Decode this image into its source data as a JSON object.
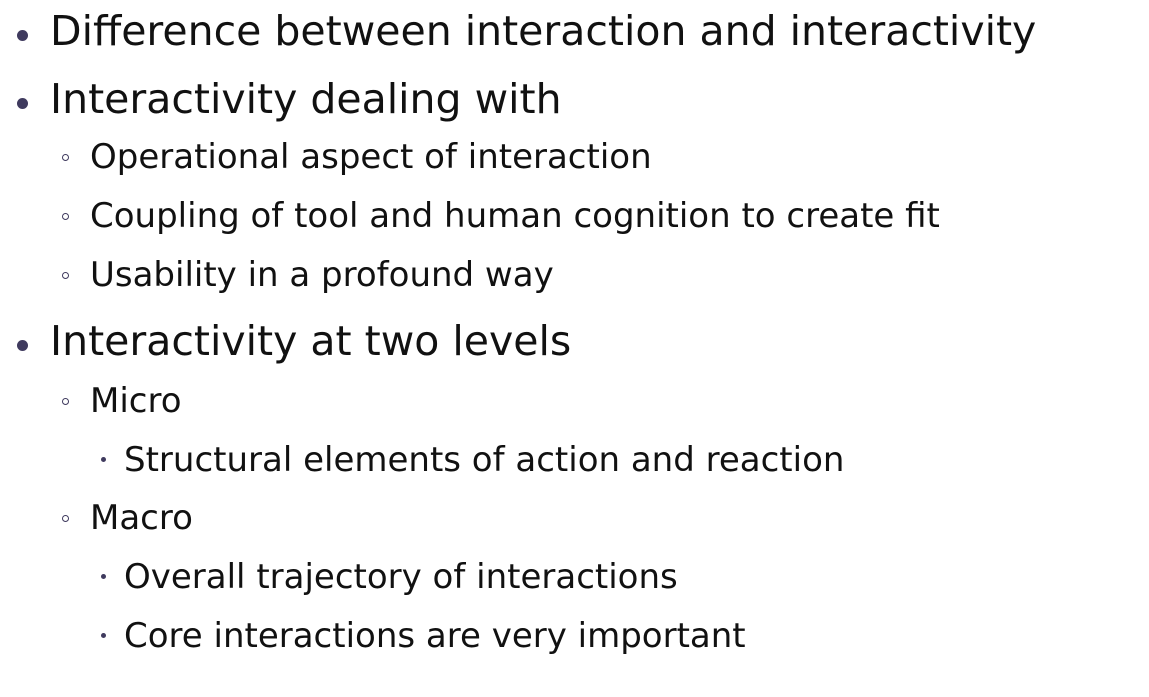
{
  "slide": {
    "items": [
      {
        "level": 1,
        "text": "Difference between interaction and interactivity"
      },
      {
        "level": 1,
        "text": "Interactivity dealing with"
      },
      {
        "level": 2,
        "text": "Operational aspect of interaction"
      },
      {
        "level": 2,
        "text": "Coupling of tool and human cognition to create fit"
      },
      {
        "level": 2,
        "text": "Usability in a profound way"
      },
      {
        "level": 1,
        "text": "Interactivity at two levels"
      },
      {
        "level": 2,
        "text": "Micro"
      },
      {
        "level": 3,
        "text": "Structural elements of action and reaction"
      },
      {
        "level": 2,
        "text": "Macro"
      },
      {
        "level": 3,
        "text": "Overall trajectory of interactions"
      },
      {
        "level": 3,
        "text": "Core interactions are very important"
      }
    ],
    "accent_color": "#3f3a5e"
  }
}
